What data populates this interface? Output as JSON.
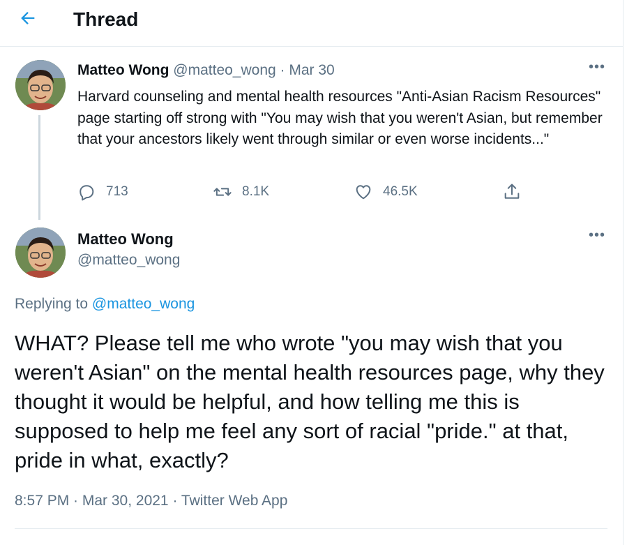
{
  "header": {
    "title": "Thread",
    "back_icon": "arrow-left-icon"
  },
  "colors": {
    "accent": "#1b95e0",
    "muted": "#5b7083",
    "text": "#0f1419",
    "border": "#e6ecf0"
  },
  "original_tweet": {
    "author_name": "Matteo Wong",
    "handle": "@matteo_wong",
    "separator": "·",
    "date": "Mar 30",
    "more_label": "•••",
    "text": "Harvard counseling and mental health resources \"Anti-Asian Racism Resources\" page starting off strong with \"You may wish that you weren't Asian, but remember that your ancestors likely went through similar or even worse incidents...\"",
    "actions": {
      "replies": "713",
      "retweets": "8.1K",
      "likes": "46.5K"
    }
  },
  "focused_tweet": {
    "author_name": "Matteo Wong",
    "handle": "@matteo_wong",
    "more_label": "•••",
    "replying_prefix": "Replying to",
    "replying_to": "@matteo_wong",
    "text": "WHAT? Please tell me who wrote \"you may wish that you weren't Asian\" on the mental health resources page, why they thought it would be helpful, and how telling me this is supposed to help me feel any sort of racial \"pride.\" at that, pride in what, exactly?",
    "meta": "8:57 PM · Mar 30, 2021 · Twitter Web App"
  }
}
